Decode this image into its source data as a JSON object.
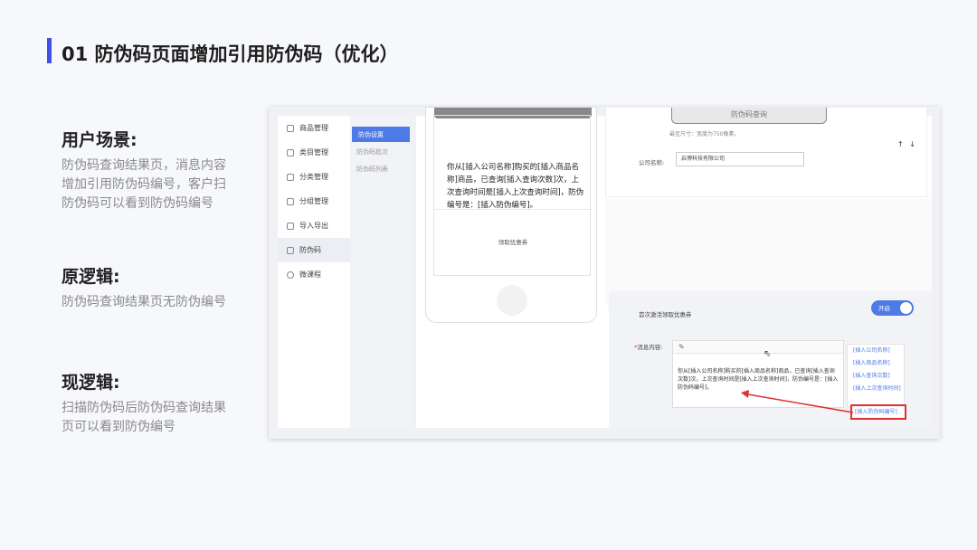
{
  "slide": {
    "title": "01 防伪码页面增加引用防伪码（优化）",
    "accent_color": "#3f51e8"
  },
  "sections": [
    {
      "heading": "用户场景:",
      "body": "防伪码查询结果页，消息内容增加引用防伪码编号，客户扫防伪码可以看到防伪码编号"
    },
    {
      "heading": "原逻辑:",
      "body": "防伪码查询结果页无防伪编号"
    },
    {
      "heading": "现逻辑:",
      "body": "扫描防伪码后防伪码查询结果页可以看到防伪编号"
    }
  ],
  "app": {
    "menu": [
      {
        "label": "商品管理",
        "icon": "box-icon"
      },
      {
        "label": "类目管理",
        "icon": "category-icon"
      },
      {
        "label": "分类管理",
        "icon": "grid-icon"
      },
      {
        "label": "分组管理",
        "icon": "group-icon"
      },
      {
        "label": "导入导出",
        "icon": "import-icon"
      },
      {
        "label": "防伪码",
        "icon": "barcode-icon"
      },
      {
        "label": "微课程",
        "icon": "course-icon"
      }
    ],
    "submenu": [
      "防伪设置",
      "防伪码批次",
      "防伪码列表"
    ],
    "phone": {
      "message": "你从[插入公司名称]购买的[插入商品名称]商品，已查询[插入查询次数]次，上次查询时间是[插入上次查询时间]，防伪编号是：[插入防伪编号]。",
      "coupon_label": "领取优惠券"
    },
    "top_card": {
      "header_button": "防伪码查询",
      "size_hint": "最佳尺寸：宽度为750像素。",
      "sort_arrows": "↑ ↓",
      "company_label": "公司名称:",
      "company_value": "启博科技有限公司"
    },
    "bottom_card": {
      "coupon_toggle_label": "首次激活领取优惠券",
      "toggle_state": "开启",
      "message_label": "消息内容:",
      "message_star": "*",
      "editor_icon": "✎",
      "message_text": "你从[插入公司名称]购买的[插入商品名称]商品，已查询[插入查询次数]次，上次查询时间是[插入上次查询时间]，防伪编号是：[插入防伪码编号]。",
      "variables": [
        "[插入公司名称]",
        "[插入商品名称]",
        "[插入查询次数]",
        "[插入上次查询时间]"
      ],
      "highlighted_variable": "[插入防伪码编号]"
    }
  }
}
